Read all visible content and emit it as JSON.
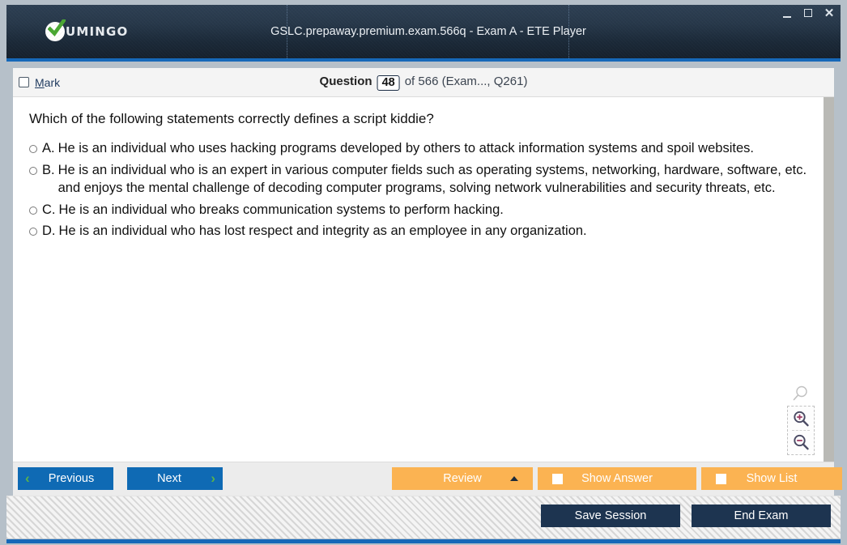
{
  "window": {
    "logo_text": "UMINGO",
    "logo_icon": "check-circle-icon",
    "title": "GSLC.prepaway.premium.exam.566q - Exam A - ETE Player",
    "minimize_label": "–",
    "maximize_label": "□",
    "close_label": "✕"
  },
  "metabar": {
    "mark_label_prefix": "M",
    "mark_label_rest": "ark",
    "question_word": "Question",
    "question_number": "48",
    "of_text": "of 566 (Exam..., Q261)"
  },
  "question": {
    "text": "Which of the following statements correctly defines a script kiddie?",
    "options": [
      {
        "letter": "A.",
        "text": "He is an individual who uses hacking programs developed by others to attack information systems and spoil websites.",
        "selected": false
      },
      {
        "letter": "B.",
        "text": "He is an individual who is an expert in various computer fields such as operating systems, networking, hardware, software, etc. and enjoys the mental challenge of decoding computer programs, solving network vulnerabilities and security threats, etc.",
        "selected": false
      },
      {
        "letter": "C.",
        "text": "He is an individual who breaks communication systems to perform hacking.",
        "selected": false
      },
      {
        "letter": "D.",
        "text": "He is an individual who has lost respect and integrity as an employee in any organization.",
        "selected": false
      }
    ]
  },
  "zoom_tools": {
    "magnifier_icon": "magnifier-icon",
    "zoom_in_icon": "zoom-in-icon",
    "zoom_out_icon": "zoom-out-icon"
  },
  "actionbar": {
    "previous_label": "Previous",
    "next_label": "Next",
    "previous_chevron": "‹",
    "next_chevron": "›",
    "review_label": "Review",
    "show_answer_label": "Show Answer",
    "show_list_label": "Show List"
  },
  "footer": {
    "save_session_label": "Save Session",
    "end_exam_label": "End Exam"
  },
  "colors": {
    "titlebar_dark": "#1b2938",
    "accent_blue": "#1668b8",
    "button_blue": "#0f6ab4",
    "button_orange": "#fbb352",
    "button_navy": "#1d3450",
    "chevron_green": "#5ab34a",
    "logo_check_green": "#4aa832"
  }
}
